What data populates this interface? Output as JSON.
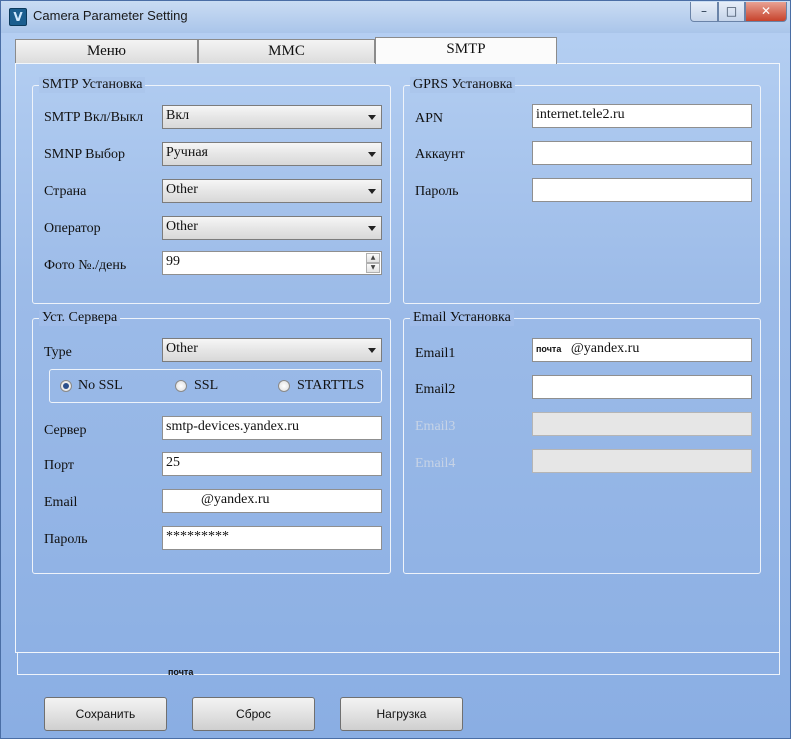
{
  "window": {
    "title": "Camera Parameter Setting",
    "minimize": "–",
    "maximize": "□",
    "close": "✕"
  },
  "tabs": [
    {
      "label": "Меню"
    },
    {
      "label": "MMC"
    },
    {
      "label": "SMTP",
      "active": true
    }
  ],
  "smtp_setup": {
    "title": "SMTP Установка",
    "rows": [
      {
        "label": "SMTP Вкл/Выкл",
        "value": "Вкл"
      },
      {
        "label": "SMNP Выбор",
        "value": "Ручная"
      },
      {
        "label": "Страна",
        "value": "Other"
      },
      {
        "label": "Оператор",
        "value": "Other"
      },
      {
        "label": "Фото №./день",
        "value": "99"
      }
    ]
  },
  "gprs_setup": {
    "title": "GPRS Установка",
    "rows": [
      {
        "label": "APN",
        "value": "internet.tele2.ru"
      },
      {
        "label": "Аккаунт",
        "value": ""
      },
      {
        "label": "Пароль",
        "value": ""
      }
    ]
  },
  "server_setup": {
    "title": "Уст. Сервера",
    "type_label": "Type",
    "type_value": "Other",
    "ssl_options": [
      "No SSL",
      "SSL",
      "STARTTLS"
    ],
    "ssl_selected": "No SSL",
    "server_label": "Сервер",
    "server_value": "smtp-devices.yandex.ru",
    "port_label": "Порт",
    "port_value": "25",
    "email_label": "Email",
    "email_value": "@yandex.ru",
    "password_label": "Пароль",
    "password_value": "*********"
  },
  "email_setup": {
    "title": "Email Установка",
    "rows": [
      {
        "label": "Email1",
        "prefix": "почта",
        "value": "@yandex.ru",
        "enabled": true
      },
      {
        "label": "Email2",
        "value": "",
        "enabled": true
      },
      {
        "label": "Email3",
        "value": "",
        "enabled": false
      },
      {
        "label": "Email4",
        "value": "",
        "enabled": false
      }
    ]
  },
  "bottom_strip_text": "почта",
  "buttons": {
    "save": "Сохранить",
    "reset": "Сброс",
    "load": "Нагрузка"
  }
}
